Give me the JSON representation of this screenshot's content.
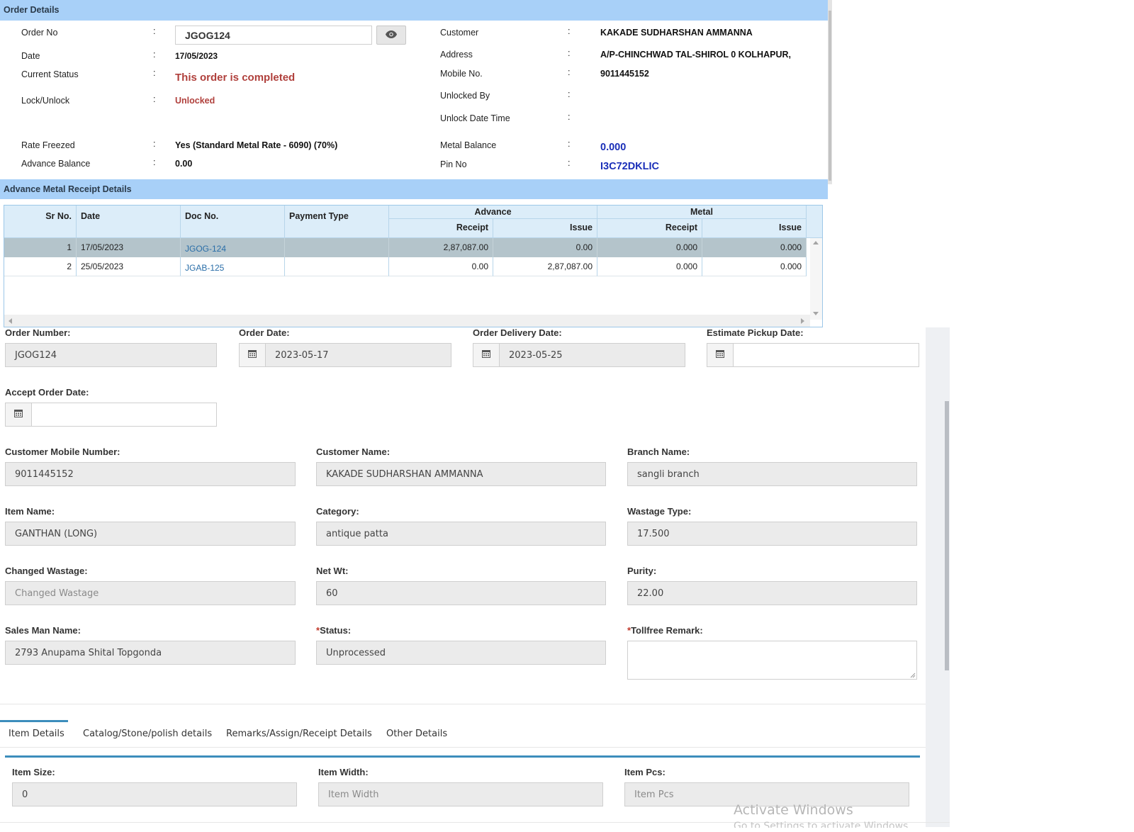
{
  "order_details": {
    "header": "Order Details",
    "left": {
      "order_no_label": "Order No",
      "order_no_value": "JGOG124",
      "date_label": "Date",
      "date_value": "17/05/2023",
      "current_status_label": "Current Status",
      "current_status_value": "This order is completed",
      "lock_label": "Lock/Unlock",
      "lock_value": "Unlocked",
      "rate_freezed_label": "Rate Freezed",
      "rate_freezed_value": "Yes (Standard Metal Rate - 6090) (70%)",
      "advance_balance_label": "Advance Balance",
      "advance_balance_value": "0.00"
    },
    "right": {
      "customer_label": "Customer",
      "customer_value": "KAKADE SUDHARSHAN AMMANNA",
      "address_label": "Address",
      "address_value": "A/P-CHINCHWAD TAL-SHIROL 0 KOLHAPUR,",
      "mobile_label": "Mobile No.",
      "mobile_value": "9011445152",
      "unlocked_by_label": "Unlocked By",
      "unlock_dt_label": "Unlock Date Time",
      "metal_balance_label": "Metal Balance",
      "metal_balance_value": "0.000",
      "pin_label": "Pin No",
      "pin_value": "I3C72DKLIC"
    },
    "colon": ":",
    "eye_icon": "eye-icon"
  },
  "advance_metal": {
    "header": "Advance Metal Receipt Details",
    "columns": {
      "sr_no": "Sr No.",
      "date": "Date",
      "doc_no": "Doc No.",
      "payment_type": "Payment Type",
      "advance": "Advance",
      "metal": "Metal",
      "receipt": "Receipt",
      "issue": "Issue"
    },
    "rows": [
      {
        "sr": "1",
        "date": "17/05/2023",
        "doc": "JGOG-124",
        "payment": "",
        "adv_receipt": "2,87,087.00",
        "adv_issue": "0.00",
        "metal_receipt": "0.000",
        "metal_issue": "0.000"
      },
      {
        "sr": "2",
        "date": "25/05/2023",
        "doc": "JGAB-125",
        "payment": "",
        "adv_receipt": "0.00",
        "adv_issue": "2,87,087.00",
        "metal_receipt": "0.000",
        "metal_issue": "0.000"
      }
    ]
  },
  "form": {
    "order_number": {
      "label": "Order Number:",
      "value": "JGOG124"
    },
    "order_date": {
      "label": "Order Date:",
      "value": "2023-05-17"
    },
    "order_delivery_date": {
      "label": "Order Delivery Date:",
      "value": "2023-05-25"
    },
    "estimate_pickup_date": {
      "label": "Estimate Pickup Date:",
      "value": ""
    },
    "accept_order_date": {
      "label": "Accept Order Date:",
      "value": ""
    },
    "customer_mobile": {
      "label": "Customer Mobile Number:",
      "value": "9011445152"
    },
    "customer_name": {
      "label": "Customer Name:",
      "value": "KAKADE SUDHARSHAN AMMANNA"
    },
    "branch_name": {
      "label": "Branch Name:",
      "value": "sangli branch"
    },
    "item_name": {
      "label": "Item Name:",
      "value": "GANTHAN (LONG)"
    },
    "category": {
      "label": "Category:",
      "value": "antique patta"
    },
    "wastage_type": {
      "label": "Wastage Type:",
      "value": "17.500"
    },
    "changed_wastage": {
      "label": "Changed Wastage:",
      "placeholder": "Changed Wastage"
    },
    "net_wt": {
      "label": "Net Wt:",
      "value": "60"
    },
    "purity": {
      "label": "Purity:",
      "value": "22.00"
    },
    "sales_man": {
      "label": "Sales Man Name:",
      "value": "2793 Anupama Shital Topgonda"
    },
    "status": {
      "required": "*",
      "label": "Status:",
      "value": "Unprocessed"
    },
    "tollfree_remark": {
      "required": "*",
      "label": "Tollfree Remark:",
      "value": ""
    }
  },
  "tabs": [
    {
      "label": "Item Details",
      "active": true
    },
    {
      "label": "Catalog/Stone/polish details",
      "active": false
    },
    {
      "label": "Remarks/Assign/Receipt Details",
      "active": false
    },
    {
      "label": "Other Details",
      "active": false
    }
  ],
  "item_details": {
    "item_size": {
      "label": "Item Size:",
      "value": "0"
    },
    "item_width": {
      "label": "Item Width:",
      "placeholder": "Item Width"
    },
    "item_pcs": {
      "label": "Item Pcs:",
      "placeholder": "Item Pcs"
    }
  },
  "watermark": {
    "line1": "Activate Windows",
    "line2": "Go to Settings to activate Windows."
  },
  "colors": {
    "section_header": "#a8d0f8",
    "status_red": "#b0403c",
    "blue_value": "#1a2fb8",
    "tab_accent": "#3c8dbc"
  }
}
